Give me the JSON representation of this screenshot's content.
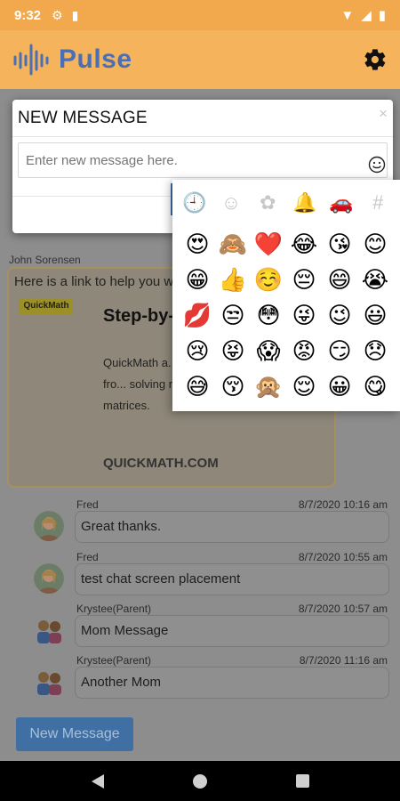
{
  "status_bar": {
    "time": "9:32"
  },
  "app": {
    "brand": "Pulse"
  },
  "background_chat": {
    "top_sender": "John Sorensen",
    "link_card": {
      "intro": "Here is a link to help you w",
      "logo_text": "QuickMath",
      "title": "Step-by-Step Problem",
      "description": "QuickMath a... instant soluti... problems, fro... solving right through to calculus and matrices.",
      "domain": "QUICKMATH.COM"
    },
    "messages": [
      {
        "sender": "Fred",
        "time": "8/7/2020 10:16 am",
        "text": "Great thanks."
      },
      {
        "sender": "Fred",
        "time": "8/7/2020 10:55 am",
        "text": "test chat screen placement"
      },
      {
        "sender": "Krystee(Parent)",
        "time": "8/7/2020 10:57 am",
        "text": "Mom Message"
      },
      {
        "sender": "Krystee(Parent)",
        "time": "8/7/2020 11:16 am",
        "text": "Another Mom"
      }
    ],
    "new_message_button": "New Message"
  },
  "modal": {
    "title": "NEW MESSAGE",
    "close": "×",
    "input_placeholder": "Enter new message here."
  },
  "emoji_picker": {
    "tabs": [
      {
        "icon": "clock-icon",
        "glyph": "🕘",
        "active": true
      },
      {
        "icon": "smiley-icon",
        "glyph": "☺",
        "active": false
      },
      {
        "icon": "flower-icon",
        "glyph": "✿",
        "active": false
      },
      {
        "icon": "bell-icon",
        "glyph": "🔔",
        "active": false
      },
      {
        "icon": "car-icon",
        "glyph": "🚗",
        "active": false
      },
      {
        "icon": "hashtag-icon",
        "glyph": "#",
        "active": false
      }
    ],
    "emojis": [
      "😍",
      "🙈",
      "❤️",
      "😂",
      "😘",
      "😊",
      "😁",
      "👍",
      "☺️",
      "😔",
      "😄",
      "😭",
      "💋",
      "😒",
      "😳",
      "😜",
      "😉",
      "😃",
      "😢",
      "😝",
      "😱",
      "😡",
      "😏",
      "😞",
      "😅",
      "😚",
      "🙊",
      "😌",
      "😀",
      "😋"
    ]
  },
  "colors": {
    "accent": "#f5b35b",
    "brand": "#4a6fb5",
    "active_tab": "#4a8fcf",
    "button": "#3f6fa3"
  }
}
